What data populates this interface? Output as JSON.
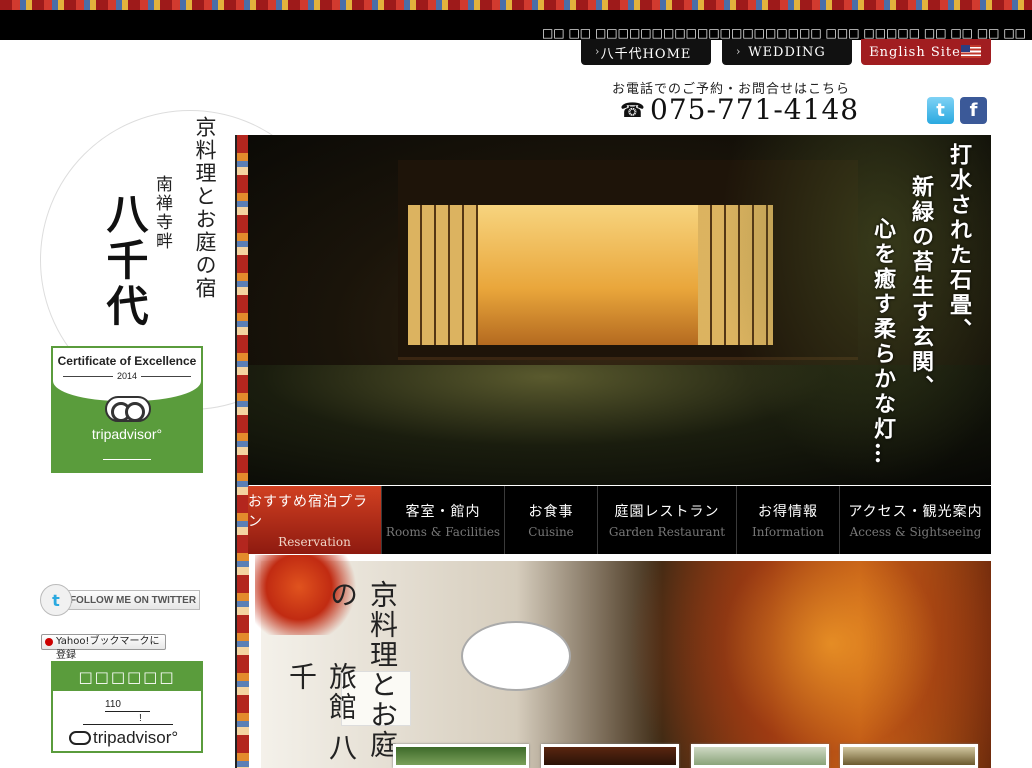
{
  "header": {
    "ticker": "□□ □□ □□□□□□□□□□□□□□□□□□□□ □□□ □□□□□ □□ □□ □□ □□",
    "nav": [
      {
        "label": "八千代HOME"
      },
      {
        "label": "WEDDING"
      },
      {
        "label": "English Site"
      }
    ],
    "phone_caption": "お電話でのご予約・お問合せはこちら",
    "phone_icon": "☎",
    "phone_number": "075-771-4148",
    "social": [
      {
        "icon": "twitter-icon",
        "glyph": "t",
        "color": "#2aa9e0"
      },
      {
        "icon": "facebook-icon",
        "glyph": "f",
        "color": "#3b5998"
      }
    ]
  },
  "logo": {
    "main": "京料理とお庭の宿",
    "sub": "南禅寺畔",
    "name": "八千代"
  },
  "certificate": {
    "title": "Certificate of Excellence",
    "year": "2014",
    "brand": "tripadvisor°"
  },
  "sidebar": {
    "follow_twitter": "FOLLOW ME ON TWITTER",
    "follow_glyph": "t",
    "yahoo_bookmark": "Yahoo!ブックマークに登録",
    "ta_widget": {
      "header": "□□□□□□",
      "count": "110",
      "mark": "!",
      "brand": "tripadvisor°"
    }
  },
  "hero": {
    "lines": [
      "打水された石畳、",
      "新緑の苔生す玄関、",
      "心を癒す柔らかな灯…"
    ]
  },
  "main_nav": [
    {
      "jp": "おすすめ宿泊プラン",
      "en": "Reservation",
      "active": true
    },
    {
      "jp": "客室・館内",
      "en": "Rooms & Facilities",
      "active": false
    },
    {
      "jp": "お食事",
      "en": "Cuisine",
      "active": false
    },
    {
      "jp": "庭園レストラン",
      "en": "Garden Restaurant",
      "active": false
    },
    {
      "jp": "お得情報",
      "en": "Information",
      "active": false
    },
    {
      "jp": "アクセス・観光案内",
      "en": "Access & Sightseeing",
      "active": false
    }
  ],
  "banner": {
    "title_line1": "京料理とお庭の",
    "title_line2": "旅館 八千"
  },
  "colors": {
    "accent_red": "#a11d20",
    "tripadvisor_green": "#5a9c3c",
    "nav_bg": "#000000"
  }
}
